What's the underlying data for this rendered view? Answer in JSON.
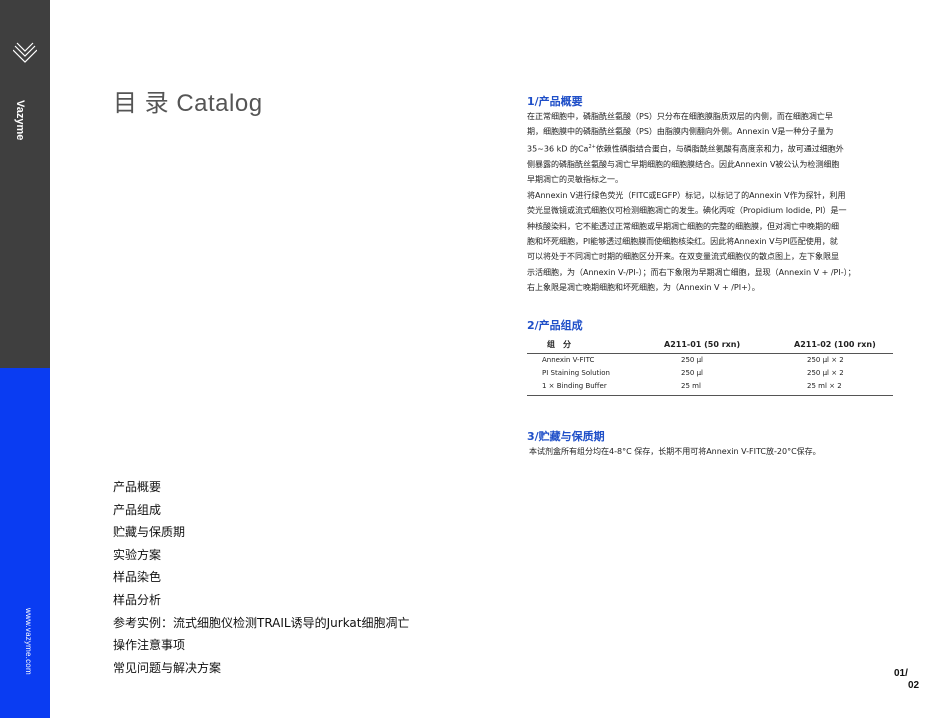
{
  "sidebar": {
    "logo_text": "Vazyme",
    "website": "www.vazyme.com",
    "colors": {
      "dark": "#3f3f3f",
      "accent": "#0a3cf2"
    }
  },
  "catalog": {
    "title": "目 录 Catalog",
    "toc": [
      "产品概要",
      "产品组成",
      "贮藏与保质期",
      "实验方案",
      "样品染色",
      "样品分析",
      "参考实例：流式细胞仪检测TRAIL诱导的Jurkat细胞凋亡",
      "操作注意事项",
      "常见问题与解决方案"
    ]
  },
  "sections": {
    "overview": {
      "heading": "1/产品概要",
      "lines": [
        "在正常细胞中，磷脂酰丝氨酸（PS）只分布在细胞膜脂质双层的内侧，而在细胞凋亡早",
        "期，细胞膜中的磷脂酰丝氨酸（PS）由脂膜内侧翻向外侧。Annexin V是一种分子量为",
        "35~36 kD 的Ca",
        "2+",
        "依赖性磷脂结合蛋白，与磷脂酰丝氨酸有高度亲和力，故可通过细胞外",
        "侧暴露的磷脂酰丝氨酸与凋亡早期细胞的细胞膜结合。因此Annexin V被公认为检测细胞",
        "早期凋亡的灵敏指标之一。",
        "将Annexin V进行绿色荧光（FITC或EGFP）标记，以标记了的Annexin V作为探针，利用",
        "荧光显微镜或流式细胞仪可检测细胞凋亡的发生。碘化丙啶（Propidium Iodide, PI）是一",
        "种核酸染料，它不能透过正常细胞或早期凋亡细胞的完整的细胞膜，但对凋亡中晚期的细",
        "胞和坏死细胞，PI能够透过细胞膜而使细胞核染红。因此将Annexin V与PI匹配使用，就",
        "可以将处于不同凋亡时期的细胞区分开来。在双变量流式细胞仪的散点图上，左下象限显",
        "示活细胞，为（Annexin V-/PI-）；而右下象限为早期凋亡细胞，显现（Annexin V + /PI-）；",
        "右上象限是凋亡晚期细胞和坏死细胞，为（Annexin V + /PI+）。"
      ]
    },
    "components": {
      "heading": "2/产品组成",
      "headers": [
        "组　分",
        "A211-01 (50 rxn)",
        "A211-02 (100 rxn)"
      ],
      "rows": [
        [
          "Annexin V-FITC",
          "250 μl",
          "250 μl × 2"
        ],
        [
          "PI Staining Solution",
          "250 μl",
          "250 μl × 2"
        ],
        [
          "1 × Binding Buffer",
          "25 ml",
          "25 ml × 2"
        ]
      ]
    },
    "storage": {
      "heading": "3/贮藏与保质期",
      "text": "本试剂盒所有组分均在4-8°C 保存，长期不用可将Annexin V-FITC放-20°C保存。"
    }
  },
  "page": {
    "number_top": "01/",
    "number_bottom": "02"
  }
}
